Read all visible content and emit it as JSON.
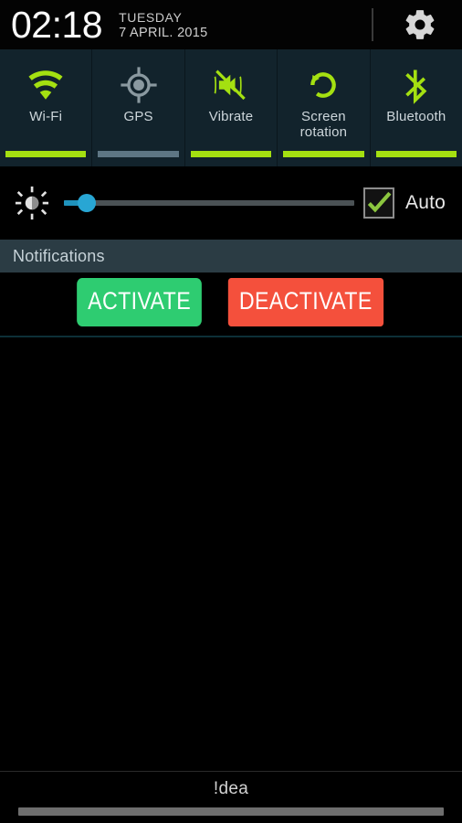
{
  "statusbar": {
    "time": "02:18",
    "day_of_week": "TUESDAY",
    "date": "7 APRIL. 2015",
    "settings_icon": "gear-icon"
  },
  "quick_toggles": [
    {
      "label": "Wi-Fi",
      "icon": "wifi-icon",
      "active": true,
      "underline_color": "#a4e011",
      "icon_color": "#a4e011"
    },
    {
      "label": "GPS",
      "icon": "gps-crosshair-icon",
      "active": false,
      "underline_color": "#5e7684",
      "icon_color": "#8a99a0"
    },
    {
      "label": "Vibrate",
      "icon": "vibrate-mute-icon",
      "active": true,
      "underline_color": "#a4e011",
      "icon_color": "#a4e011"
    },
    {
      "label": "Screen\nrotation",
      "icon": "screen-rotation-icon",
      "active": true,
      "underline_color": "#a4e011",
      "icon_color": "#a4e011"
    },
    {
      "label": "Bluetooth",
      "icon": "bluetooth-icon",
      "active": true,
      "underline_color": "#a4e011",
      "icon_color": "#a4e011"
    }
  ],
  "brightness": {
    "icon": "brightness-sun-icon",
    "value_percent": 8,
    "slider_fill_color": "#1f93bd",
    "slider_thumb_color": "#28a6d4",
    "auto_label": "Auto",
    "auto_checked": true,
    "check_color": "#8cc63f"
  },
  "notifications": {
    "title": "Notifications",
    "buttons": [
      {
        "label": "ACTIVATE",
        "color": "#2ecc71"
      },
      {
        "label": "DEACTIVATE",
        "color": "#f4503c"
      }
    ]
  },
  "bottom": {
    "brand": "!dea",
    "handle": "drag-handle"
  }
}
